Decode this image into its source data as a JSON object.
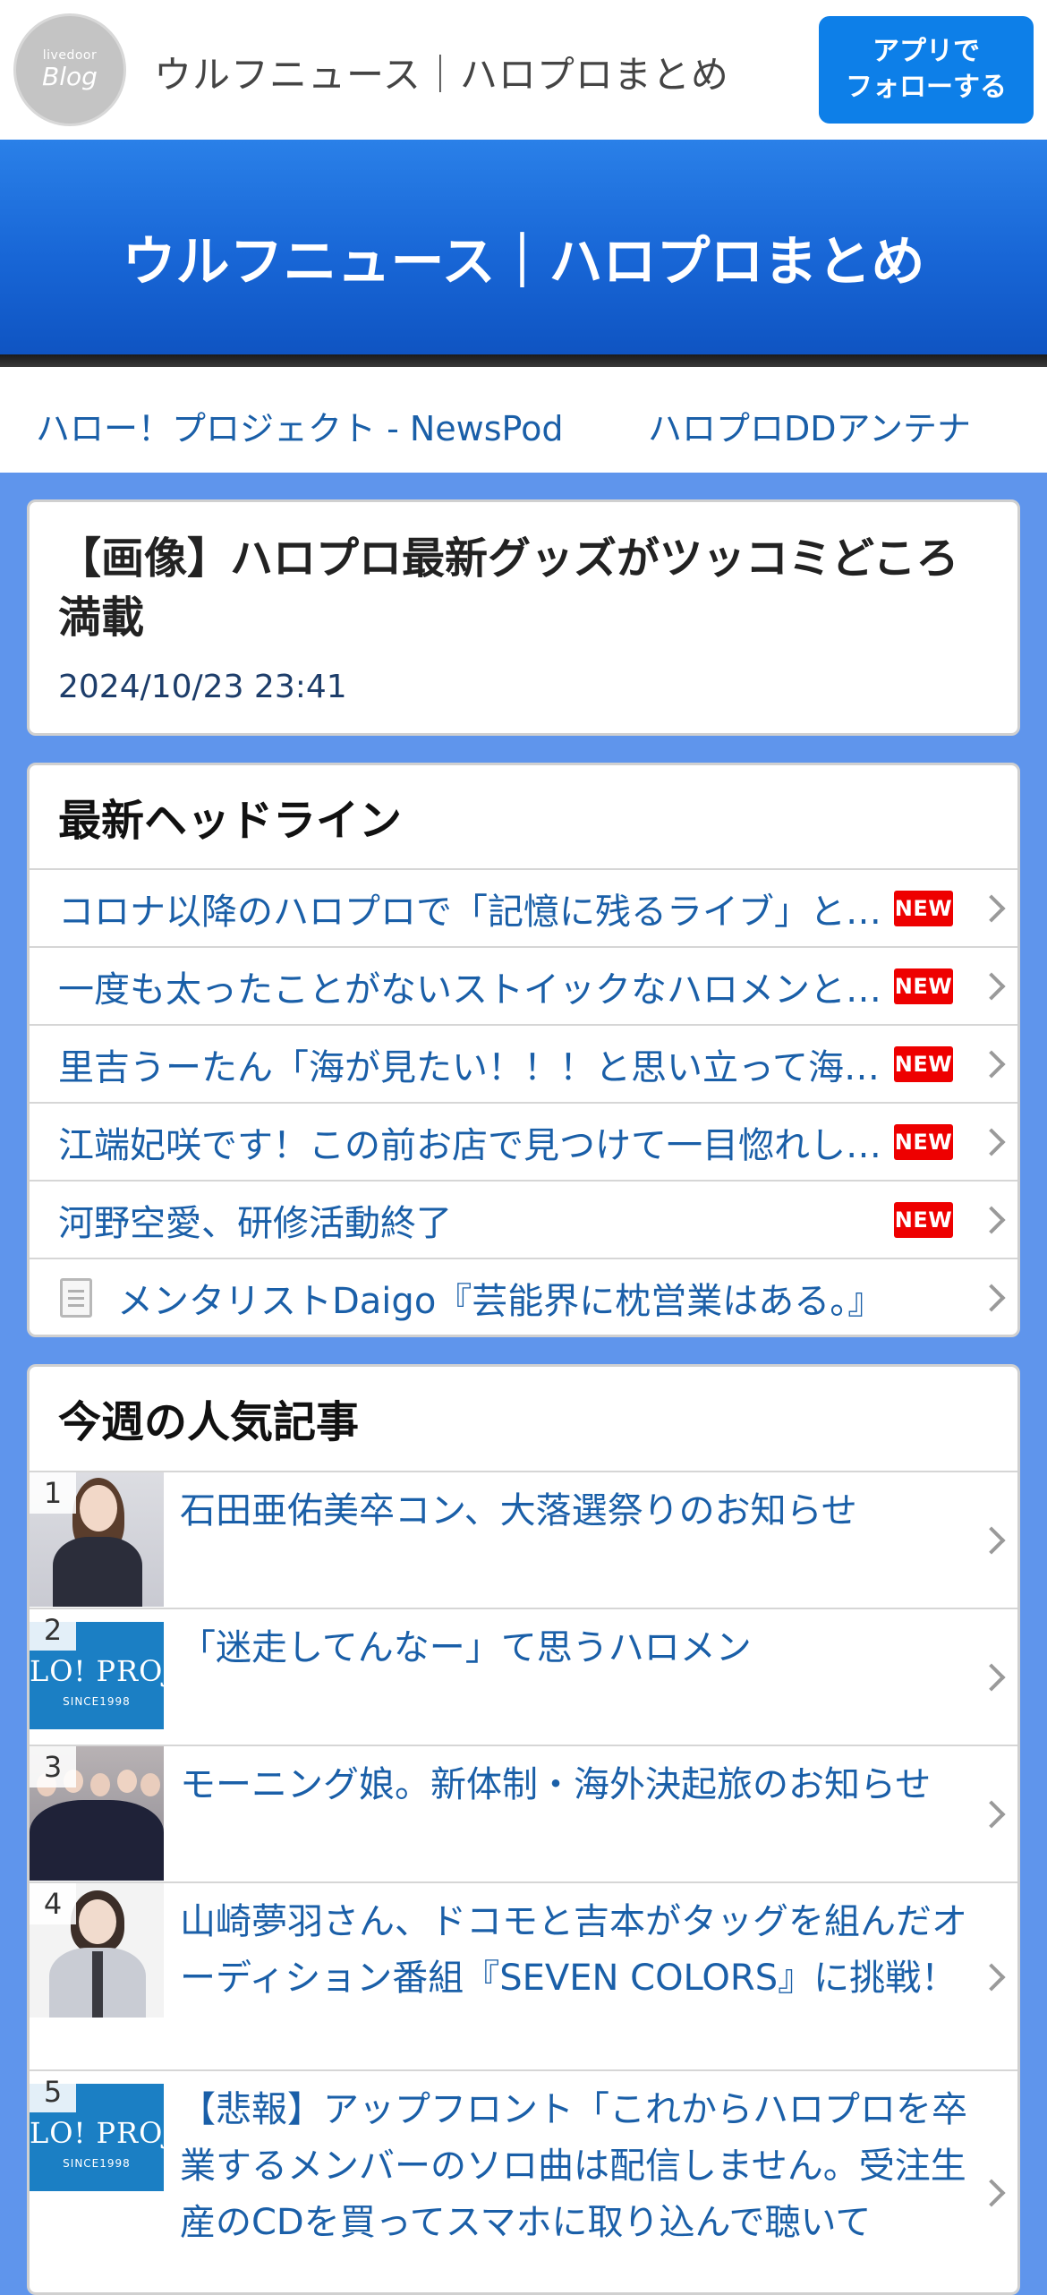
{
  "topbar": {
    "logo_small": "livedoor",
    "logo_big": "Blog",
    "title": "ウルフニュース｜ハロプロまとめ",
    "follow_line1": "アプリで",
    "follow_line2": "フォローする"
  },
  "hero": {
    "title": "ウルフニュース｜ハロプロまとめ"
  },
  "links": [
    "ハロー！プロジェクト - NewsPod",
    "ハロプロDDアンテナ"
  ],
  "article": {
    "title": "【画像】ハロプロ最新グッズがツッコミどころ満載",
    "date": "2024/10/23 23:41"
  },
  "headlines": {
    "heading": "最新ヘッドライン",
    "new_label": "NEW",
    "items": [
      {
        "text": "コロナ以降のハロプロで「記憶に残るライブ」といえば？"
      },
      {
        "text": "一度も太ったことがないストイックなハロメンといえば"
      },
      {
        "text": "里吉うーたん「海が見たい！！！と思い立って海へ行ってきました"
      },
      {
        "text": "江端妃咲です！この前お店で見つけて一目惚れしたもの"
      },
      {
        "text": "河野空愛、研修活動終了"
      },
      {
        "text": "メンタリストDaigo『芸能界に枕営業はある。』"
      }
    ]
  },
  "popular": {
    "heading": "今週の人気記事",
    "brand_text": "LO! PROJ",
    "brand_sub": "SINCE1998",
    "items": [
      {
        "rank": "1",
        "text": "石田亜佑美卒コン、大落選祭りのお知らせ"
      },
      {
        "rank": "2",
        "text": "「迷走してんなー」て思うハロメン"
      },
      {
        "rank": "3",
        "text": "モーニング娘。新体制・海外決起旅のお知らせ"
      },
      {
        "rank": "4",
        "text": "山崎夢羽さん、ドコモと吉本がタッグを組んだオーディション番組『SEVEN COLORS』に挑戦！"
      },
      {
        "rank": "5",
        "text": "【悲報】アップフロント「これからハロプロを卒業するメンバーのソロ曲は配信しません。受注生産のCDを買ってスマホに取り込んで聴いて"
      }
    ]
  },
  "colors": {
    "page_bg": "#5f95ec",
    "link": "#1a5fa8",
    "follow_button": "#0d7fe8",
    "new_badge": "#ee0000"
  }
}
